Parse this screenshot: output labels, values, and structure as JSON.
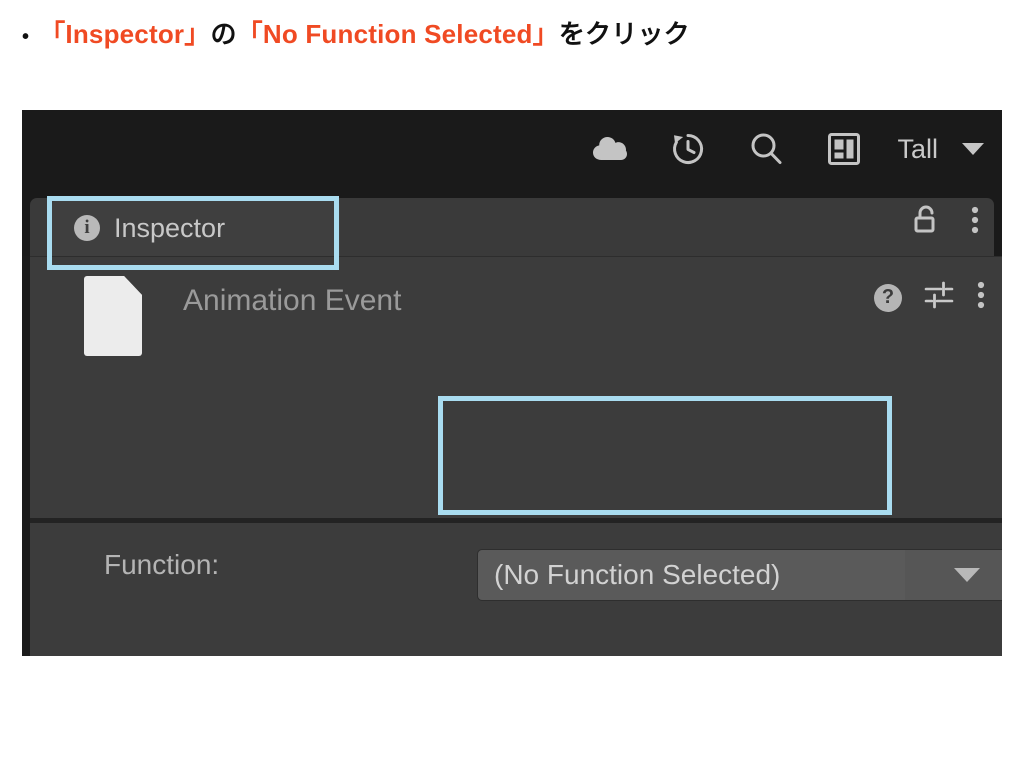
{
  "caption": {
    "bullet": "•",
    "segments": [
      {
        "text": "「Inspector」",
        "style": "em"
      },
      {
        "text": "の",
        "style": "plain"
      },
      {
        "text": "「No Function Selected」",
        "style": "em"
      },
      {
        "text": "をクリック",
        "style": "plain"
      }
    ],
    "part1": "「Inspector」",
    "part2": "の",
    "part3": "「No Function Selected」",
    "part4": "をクリック",
    "accent_color": "#f04a23"
  },
  "toolbar": {
    "icons": [
      {
        "name": "cloud-icon",
        "label": "Cloud"
      },
      {
        "name": "history-icon",
        "label": "History"
      },
      {
        "name": "search-icon",
        "label": "Search"
      },
      {
        "name": "layout-icon",
        "label": "Layout"
      }
    ],
    "layout_dropdown": {
      "value": "Tall",
      "arrow": "▼"
    }
  },
  "tabbar": {
    "tab": {
      "icon": "info-icon",
      "icon_glyph": "i",
      "label": "Inspector"
    },
    "actions": [
      {
        "name": "lock-icon",
        "label": "Lock"
      },
      {
        "name": "more-menu-icon",
        "label": "More"
      }
    ]
  },
  "component": {
    "icon": "file-icon",
    "title": "Animation Event",
    "actions": [
      {
        "name": "help-icon",
        "label": "Help",
        "glyph": "?"
      },
      {
        "name": "preset-settings-icon",
        "label": "Preset"
      },
      {
        "name": "more-menu-icon",
        "label": "More"
      }
    ]
  },
  "property": {
    "label": "Function:",
    "dropdown_value": "(No Function Selected)",
    "dropdown_arrow": "▼"
  },
  "highlights": {
    "color": "#a9dcf0",
    "boxes": [
      {
        "name": "inspector-tab-highlight",
        "target": "Inspector"
      },
      {
        "name": "function-dropdown-highlight",
        "target": "(No Function Selected)"
      }
    ]
  },
  "theme": {
    "panel_background": "#383838",
    "toolbar_background": "#1a1a1a",
    "component_background": "#3c3c3c",
    "field_background": "#5a5a5a",
    "text_color": "#c8c8c8"
  }
}
